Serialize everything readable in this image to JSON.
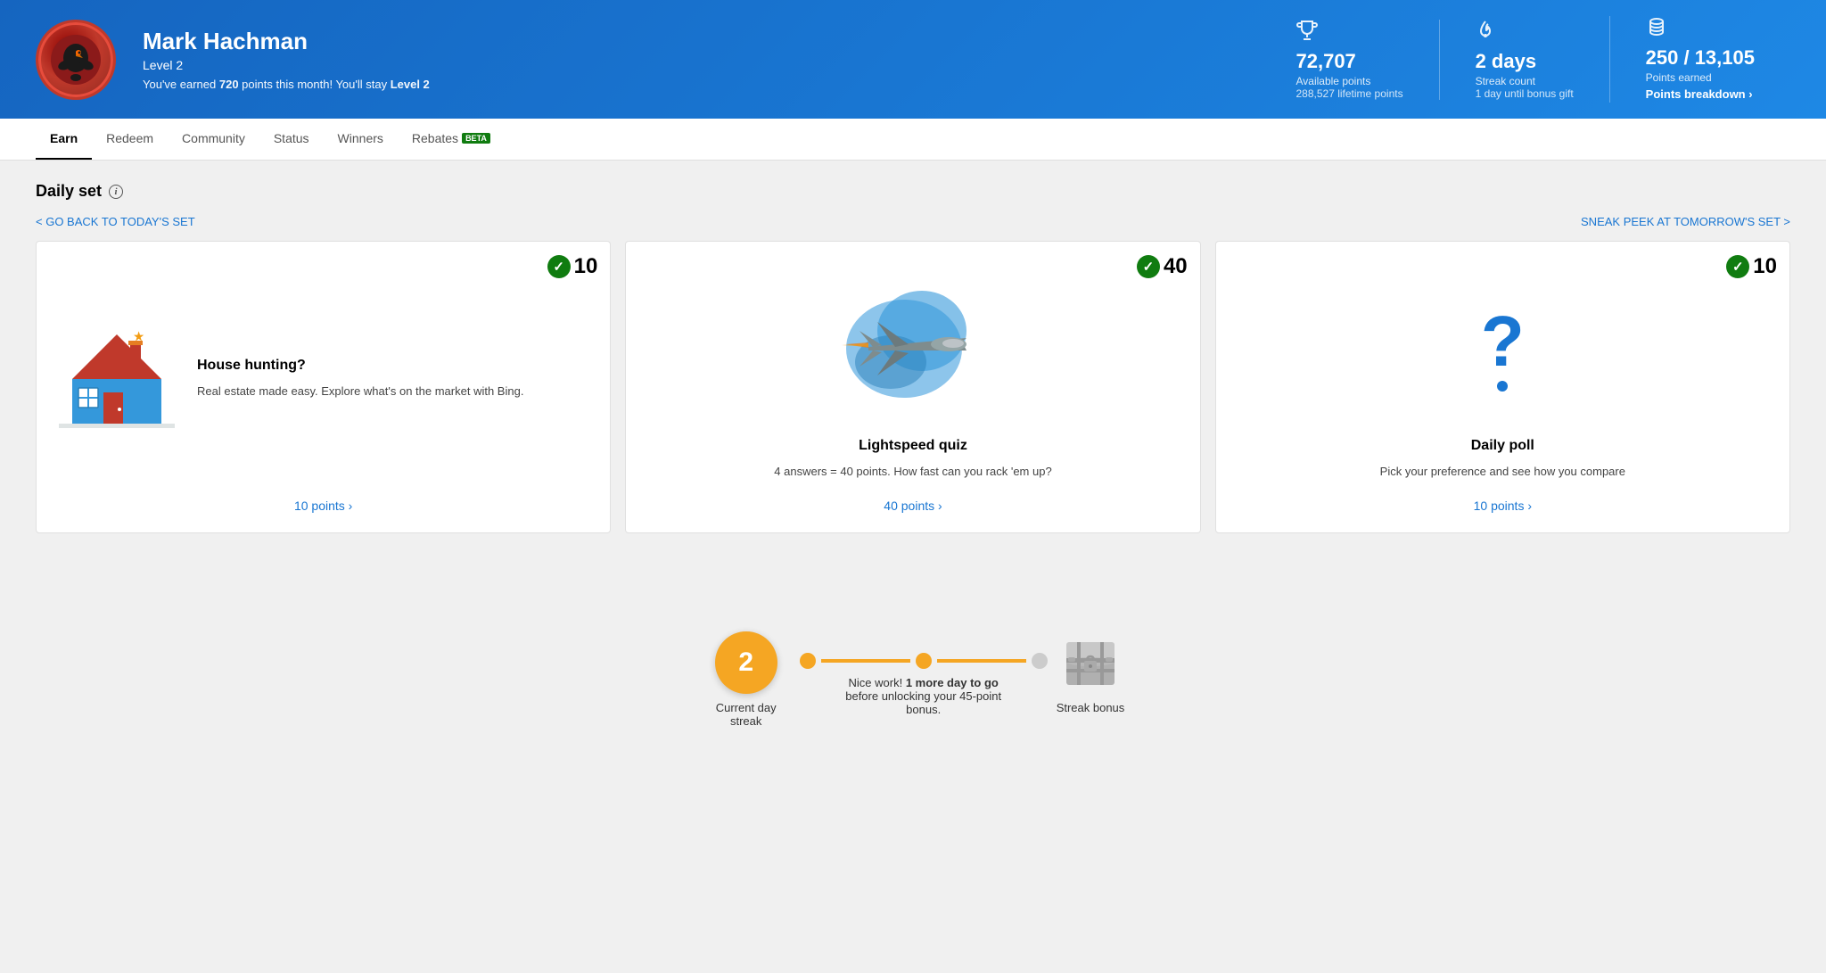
{
  "header": {
    "user_name": "Mark Hachman",
    "user_level": "Level 2",
    "user_message_prefix": "You've earned ",
    "user_points_earned": "720",
    "user_message_suffix": " points this month! You'll stay ",
    "user_level_stay": "Level 2",
    "stats": [
      {
        "icon": "🏆",
        "value": "72,707",
        "label": "Available points",
        "sub": "288,527 lifetime points"
      },
      {
        "icon": "🔥",
        "value": "2 days",
        "label": "Streak count",
        "sub": "1 day until bonus gift"
      },
      {
        "icon": "💰",
        "value": "250 / 13,105",
        "label": "Points earned",
        "sub": "Points breakdown ›"
      }
    ]
  },
  "nav": {
    "items": [
      "Earn",
      "Redeem",
      "Community",
      "Status",
      "Winners",
      "Rebates"
    ],
    "active": "Earn",
    "beta_item": "Rebates"
  },
  "daily_set": {
    "title": "Daily set",
    "back_link": "< GO BACK TO TODAY'S SET",
    "sneak_peek": "SNEAK PEEK AT TOMORROW'S SET >",
    "cards": [
      {
        "points": "10",
        "completed": true,
        "title": "House hunting?",
        "description": "Real estate made easy. Explore what's on the market with Bing.",
        "points_label": "10 points ›",
        "type": "house"
      },
      {
        "points": "40",
        "completed": true,
        "title": "Lightspeed quiz",
        "description": "4 answers = 40 points. How fast can you rack 'em up?",
        "points_label": "40 points ›",
        "type": "jet"
      },
      {
        "points": "10",
        "completed": true,
        "title": "Daily poll",
        "description": "Pick your preference and see how you compare",
        "points_label": "10 points ›",
        "type": "question"
      }
    ]
  },
  "streak": {
    "current_day": "2",
    "current_day_label": "Current day streak",
    "middle_label_bold": "1 more day to go",
    "middle_label_before": "Nice work! ",
    "middle_label_after": " before unlocking your 45-point bonus.",
    "bonus_label": "Streak bonus"
  }
}
